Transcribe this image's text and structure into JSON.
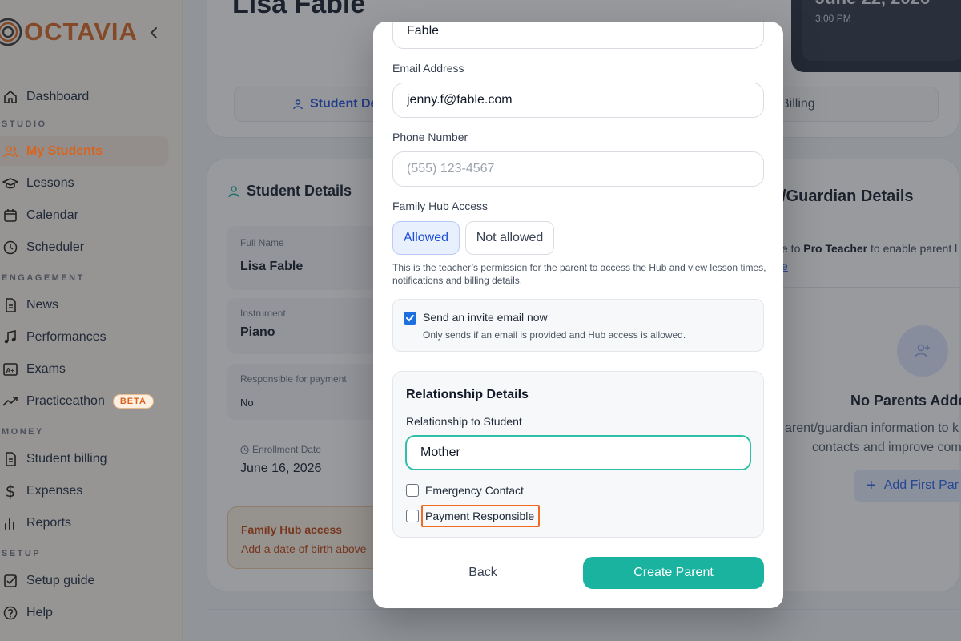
{
  "sidebar": {
    "brand": "OCTAVIA",
    "collapse_icon": "chevron-left-icon",
    "items": [
      {
        "label": "Dashboard",
        "icon": "home-icon"
      },
      {
        "section": "STUDIO"
      },
      {
        "label": "My Students",
        "icon": "users-icon",
        "active": true
      },
      {
        "label": "Lessons",
        "icon": "graduation-cap-icon"
      },
      {
        "label": "Calendar",
        "icon": "calendar-icon"
      },
      {
        "label": "Scheduler",
        "icon": "clock-icon"
      },
      {
        "section": "ENGAGEMENT"
      },
      {
        "label": "News",
        "icon": "newspaper-icon"
      },
      {
        "label": "Performances",
        "icon": "music-note-icon"
      },
      {
        "label": "Exams",
        "icon": "exam-icon"
      },
      {
        "label": "Practiceathon",
        "icon": "trending-icon",
        "badge": "BETA"
      },
      {
        "section": "MONEY"
      },
      {
        "label": "Student billing",
        "icon": "invoice-icon"
      },
      {
        "label": "Expenses",
        "icon": "dollar-icon"
      },
      {
        "label": "Reports",
        "icon": "bar-chart-icon"
      },
      {
        "section": "SETUP"
      },
      {
        "label": "Setup guide",
        "icon": "checklist-icon"
      },
      {
        "label": "Help",
        "icon": "help-icon"
      }
    ]
  },
  "page": {
    "student_name": "Lisa Fable",
    "date": "June 22, 2026",
    "time": "3:00 PM",
    "tabs": {
      "details": "Student De",
      "billing": "Billing"
    },
    "student_details_title": "Student Details",
    "fields": {
      "full_name_label": "Full Name",
      "full_name_value": "Lisa Fable",
      "instrument_label": "Instrument",
      "instrument_value": "Piano",
      "payment_label": "Responsible for payment",
      "payment_value": "No",
      "enrollment_label": "Enrollment Date",
      "enrollment_value": "June 16, 2026"
    },
    "hub_warning": {
      "title": "Family Hub access",
      "text": "Add a date of birth above"
    },
    "parent_guardian_title": "/Guardian Details",
    "pro_note_prefix": "e to ",
    "pro_note_bold": "Pro Teacher",
    "pro_note_suffix": " to enable parent l",
    "pro_link": "e",
    "no_parents_title": "No Parents Adde",
    "no_parents_desc_1": "arent/guardian information to k",
    "no_parents_desc_2": "contacts and improve com",
    "add_parent_label": "Add First Par"
  },
  "modal": {
    "last_name_value": "Fable",
    "email_label": "Email Address",
    "email_value": "jenny.f@fable.com",
    "phone_label": "Phone Number",
    "phone_placeholder": "(555) 123-4567",
    "hub_access_label": "Family Hub Access",
    "hub_allowed": "Allowed",
    "hub_not_allowed": "Not allowed",
    "hub_help": "This is the teacher’s permission for the parent to access the Hub and view lesson times, notifications and billing details.",
    "invite_label": "Send an invite email now",
    "invite_sub": "Only sends if an email is provided and Hub access is allowed.",
    "invite_checked": true,
    "relationship_title": "Relationship Details",
    "relationship_label": "Relationship to Student",
    "relationship_value": "Mother",
    "emergency_label": "Emergency Contact",
    "payment_label": "Payment Responsible",
    "back_label": "Back",
    "create_label": "Create Parent"
  },
  "colors": {
    "brand": "#d9641e",
    "primary": "#19b3a0",
    "focus": "#2fbfa6",
    "highlight": "#f46a1f",
    "link": "#1d4ed8"
  }
}
